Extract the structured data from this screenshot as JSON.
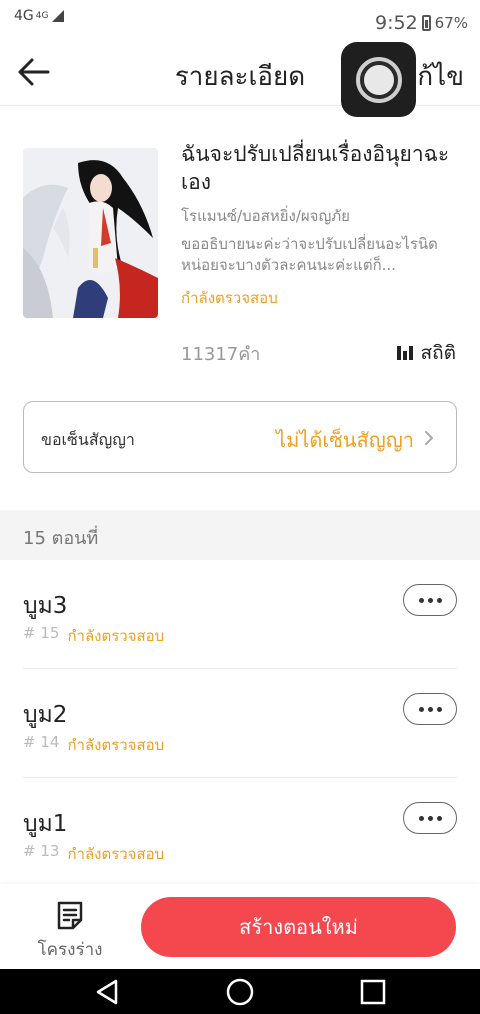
{
  "status_bar": {
    "network": "4G",
    "network_sup": "4G",
    "time": "9:52",
    "battery": "67%"
  },
  "header": {
    "title": "รายละเอียด",
    "edit": "ก้ไข"
  },
  "book": {
    "title": "ฉันจะปรับเปลี่ยนเรื่องอินุยาฉะเอง",
    "genre": "โรแมนซ์/บอสหยิ่ง/ผจญภัย",
    "description": "ขออธิบายนะค่ะว่าจะปรับเปลี่ยนอะไรนิดหน่อยจะบางตัวละคนนะค่ะแต่ก็...",
    "status": "กำลังตรวจสอบ",
    "word_count": "11317คำ",
    "stats_label": "สถิติ"
  },
  "contract": {
    "label": "ขอเซ็นสัญญา",
    "value": "ไม่ได้เซ็นสัญญา"
  },
  "chapters_header": "15 ตอนที่",
  "chapters": [
    {
      "title": "บูม3",
      "num": "# 15",
      "status": "กำลังตรวจสอบ"
    },
    {
      "title": "บูม2",
      "num": "# 14",
      "status": "กำลังตรวจสอบ"
    },
    {
      "title": "บูม1",
      "num": "# 13",
      "status": "กำลังตรวจสอบ"
    }
  ],
  "bottom": {
    "outline_label": "โครงร่าง",
    "create_label": "สร้างตอนใหม่"
  },
  "colors": {
    "accent_orange": "#f0a020",
    "primary_red": "#f5474e"
  },
  "icons": [
    "back-arrow-icon",
    "stats-icon",
    "chevron-right-icon",
    "more-icon",
    "outline-icon",
    "assistive-touch-icon"
  ]
}
